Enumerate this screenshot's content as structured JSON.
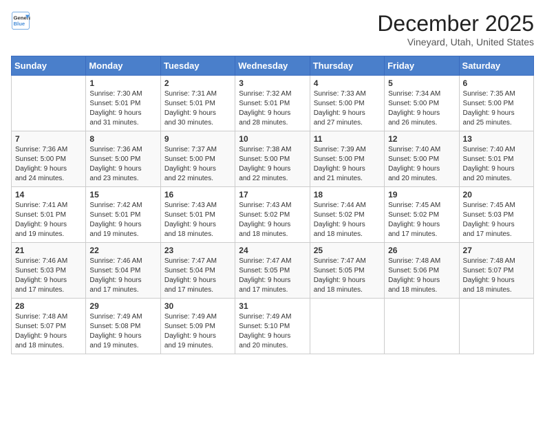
{
  "header": {
    "logo_line1": "General",
    "logo_line2": "Blue",
    "month": "December 2025",
    "location": "Vineyard, Utah, United States"
  },
  "days_of_week": [
    "Sunday",
    "Monday",
    "Tuesday",
    "Wednesday",
    "Thursday",
    "Friday",
    "Saturday"
  ],
  "weeks": [
    [
      {
        "day": "",
        "info": ""
      },
      {
        "day": "1",
        "info": "Sunrise: 7:30 AM\nSunset: 5:01 PM\nDaylight: 9 hours\nand 31 minutes."
      },
      {
        "day": "2",
        "info": "Sunrise: 7:31 AM\nSunset: 5:01 PM\nDaylight: 9 hours\nand 30 minutes."
      },
      {
        "day": "3",
        "info": "Sunrise: 7:32 AM\nSunset: 5:01 PM\nDaylight: 9 hours\nand 28 minutes."
      },
      {
        "day": "4",
        "info": "Sunrise: 7:33 AM\nSunset: 5:00 PM\nDaylight: 9 hours\nand 27 minutes."
      },
      {
        "day": "5",
        "info": "Sunrise: 7:34 AM\nSunset: 5:00 PM\nDaylight: 9 hours\nand 26 minutes."
      },
      {
        "day": "6",
        "info": "Sunrise: 7:35 AM\nSunset: 5:00 PM\nDaylight: 9 hours\nand 25 minutes."
      }
    ],
    [
      {
        "day": "7",
        "info": "Sunrise: 7:36 AM\nSunset: 5:00 PM\nDaylight: 9 hours\nand 24 minutes."
      },
      {
        "day": "8",
        "info": "Sunrise: 7:36 AM\nSunset: 5:00 PM\nDaylight: 9 hours\nand 23 minutes."
      },
      {
        "day": "9",
        "info": "Sunrise: 7:37 AM\nSunset: 5:00 PM\nDaylight: 9 hours\nand 22 minutes."
      },
      {
        "day": "10",
        "info": "Sunrise: 7:38 AM\nSunset: 5:00 PM\nDaylight: 9 hours\nand 22 minutes."
      },
      {
        "day": "11",
        "info": "Sunrise: 7:39 AM\nSunset: 5:00 PM\nDaylight: 9 hours\nand 21 minutes."
      },
      {
        "day": "12",
        "info": "Sunrise: 7:40 AM\nSunset: 5:00 PM\nDaylight: 9 hours\nand 20 minutes."
      },
      {
        "day": "13",
        "info": "Sunrise: 7:40 AM\nSunset: 5:01 PM\nDaylight: 9 hours\nand 20 minutes."
      }
    ],
    [
      {
        "day": "14",
        "info": "Sunrise: 7:41 AM\nSunset: 5:01 PM\nDaylight: 9 hours\nand 19 minutes."
      },
      {
        "day": "15",
        "info": "Sunrise: 7:42 AM\nSunset: 5:01 PM\nDaylight: 9 hours\nand 19 minutes."
      },
      {
        "day": "16",
        "info": "Sunrise: 7:43 AM\nSunset: 5:01 PM\nDaylight: 9 hours\nand 18 minutes."
      },
      {
        "day": "17",
        "info": "Sunrise: 7:43 AM\nSunset: 5:02 PM\nDaylight: 9 hours\nand 18 minutes."
      },
      {
        "day": "18",
        "info": "Sunrise: 7:44 AM\nSunset: 5:02 PM\nDaylight: 9 hours\nand 18 minutes."
      },
      {
        "day": "19",
        "info": "Sunrise: 7:45 AM\nSunset: 5:02 PM\nDaylight: 9 hours\nand 17 minutes."
      },
      {
        "day": "20",
        "info": "Sunrise: 7:45 AM\nSunset: 5:03 PM\nDaylight: 9 hours\nand 17 minutes."
      }
    ],
    [
      {
        "day": "21",
        "info": "Sunrise: 7:46 AM\nSunset: 5:03 PM\nDaylight: 9 hours\nand 17 minutes."
      },
      {
        "day": "22",
        "info": "Sunrise: 7:46 AM\nSunset: 5:04 PM\nDaylight: 9 hours\nand 17 minutes."
      },
      {
        "day": "23",
        "info": "Sunrise: 7:47 AM\nSunset: 5:04 PM\nDaylight: 9 hours\nand 17 minutes."
      },
      {
        "day": "24",
        "info": "Sunrise: 7:47 AM\nSunset: 5:05 PM\nDaylight: 9 hours\nand 17 minutes."
      },
      {
        "day": "25",
        "info": "Sunrise: 7:47 AM\nSunset: 5:05 PM\nDaylight: 9 hours\nand 18 minutes."
      },
      {
        "day": "26",
        "info": "Sunrise: 7:48 AM\nSunset: 5:06 PM\nDaylight: 9 hours\nand 18 minutes."
      },
      {
        "day": "27",
        "info": "Sunrise: 7:48 AM\nSunset: 5:07 PM\nDaylight: 9 hours\nand 18 minutes."
      }
    ],
    [
      {
        "day": "28",
        "info": "Sunrise: 7:48 AM\nSunset: 5:07 PM\nDaylight: 9 hours\nand 18 minutes."
      },
      {
        "day": "29",
        "info": "Sunrise: 7:49 AM\nSunset: 5:08 PM\nDaylight: 9 hours\nand 19 minutes."
      },
      {
        "day": "30",
        "info": "Sunrise: 7:49 AM\nSunset: 5:09 PM\nDaylight: 9 hours\nand 19 minutes."
      },
      {
        "day": "31",
        "info": "Sunrise: 7:49 AM\nSunset: 5:10 PM\nDaylight: 9 hours\nand 20 minutes."
      },
      {
        "day": "",
        "info": ""
      },
      {
        "day": "",
        "info": ""
      },
      {
        "day": "",
        "info": ""
      }
    ]
  ]
}
